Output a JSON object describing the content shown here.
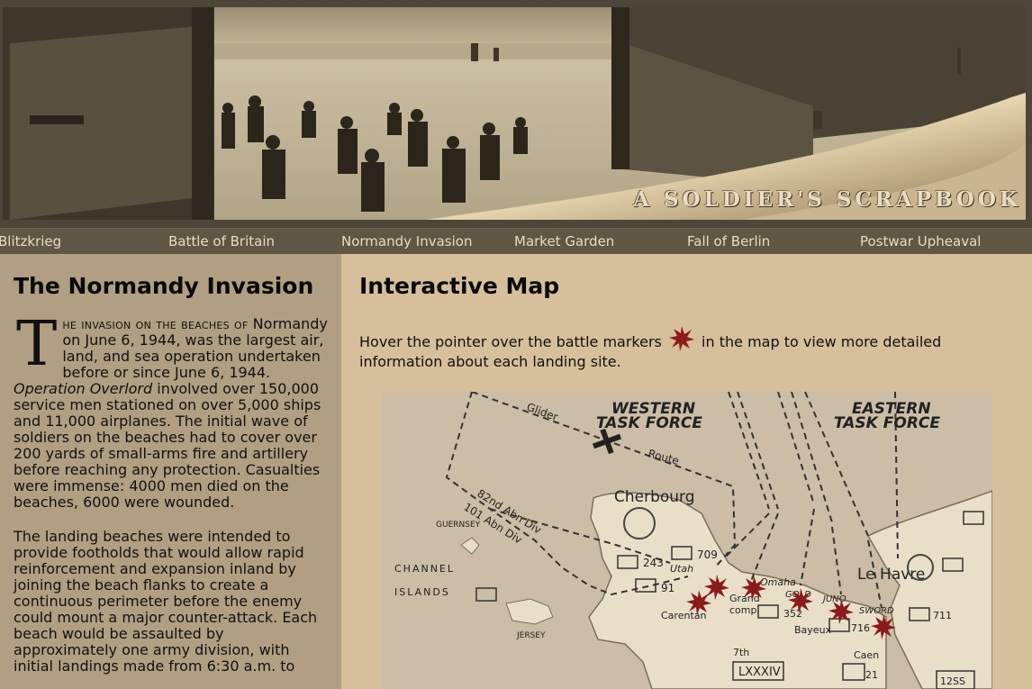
{
  "header": {
    "site_title": "A SOLDIER'S SCRAPBOOK"
  },
  "nav": {
    "items": [
      {
        "label": "Blitzkrieg"
      },
      {
        "label": "Battle of Britain"
      },
      {
        "label": "Normandy Invasion"
      },
      {
        "label": "Market Garden"
      },
      {
        "label": "Fall of Berlin"
      },
      {
        "label": "Postwar Upheaval"
      }
    ]
  },
  "article": {
    "title": "The Normandy Invasion",
    "dropcap": "T",
    "lead_small": "he invasion on the beaches of",
    "p1_rest": " Normandy on June 6, 1944, was the largest air, land, and sea operation undertaken before or since June 6, 1944. ",
    "p1_em": "Operation Overlord",
    "p1_tail": " involved over 150,000 service men stationed on over 5,000 ships and 11,000 airplanes. The initial wave of soldiers on the beaches had to cover over 200 yards of small-arms fire and artillery before reaching any protection. Casualties were immense: 4000 men died on the beaches, 6000 were wounded.",
    "p2": "The landing beaches were intended to provide footholds that would allow rapid reinforcement and expansion inland by joining the beach flanks to create a continuous perimeter before the enemy could mount a major counter-attack. Each beach would be assaulted by approximately one army division, with initial landings made from 6:30 a.m. to"
  },
  "map_section": {
    "title": "Interactive Map",
    "intro_before": "Hover the pointer over the battle markers",
    "intro_after": " in the map to view more detailed information about each landing site.",
    "marker_color": "#8b1a1a",
    "labels": {
      "western": "WESTERN",
      "western2": "TASK FORCE",
      "eastern": "EASTERN",
      "eastern2": "TASK FORCE",
      "cherbourg": "Cherbourg",
      "le_havre": "Le Havre",
      "channel": "CHANNEL",
      "islands": "ISLANDS",
      "guernsey": "GUERNSEY",
      "jersey": "JERSEY",
      "glider": "Glider",
      "route": "Route",
      "abn82": "82nd Abn Div",
      "abn101": "101 Abn Div",
      "carentan": "Carentan",
      "bayeux": "Bayeux",
      "caen": "Caen",
      "corps": "LXXXIV",
      "div709": "709",
      "div243": "243",
      "div91": "91",
      "div352": "352",
      "div716": "716",
      "div711": "711",
      "div21": "21",
      "div12ss": "12SS",
      "seventh": "7th",
      "grand": "Grand",
      "comp": "comp",
      "sword": "SWORD",
      "juno": "JUNO",
      "gold": "GOLD",
      "omaha": "Omaha",
      "utah": "Utah"
    }
  }
}
